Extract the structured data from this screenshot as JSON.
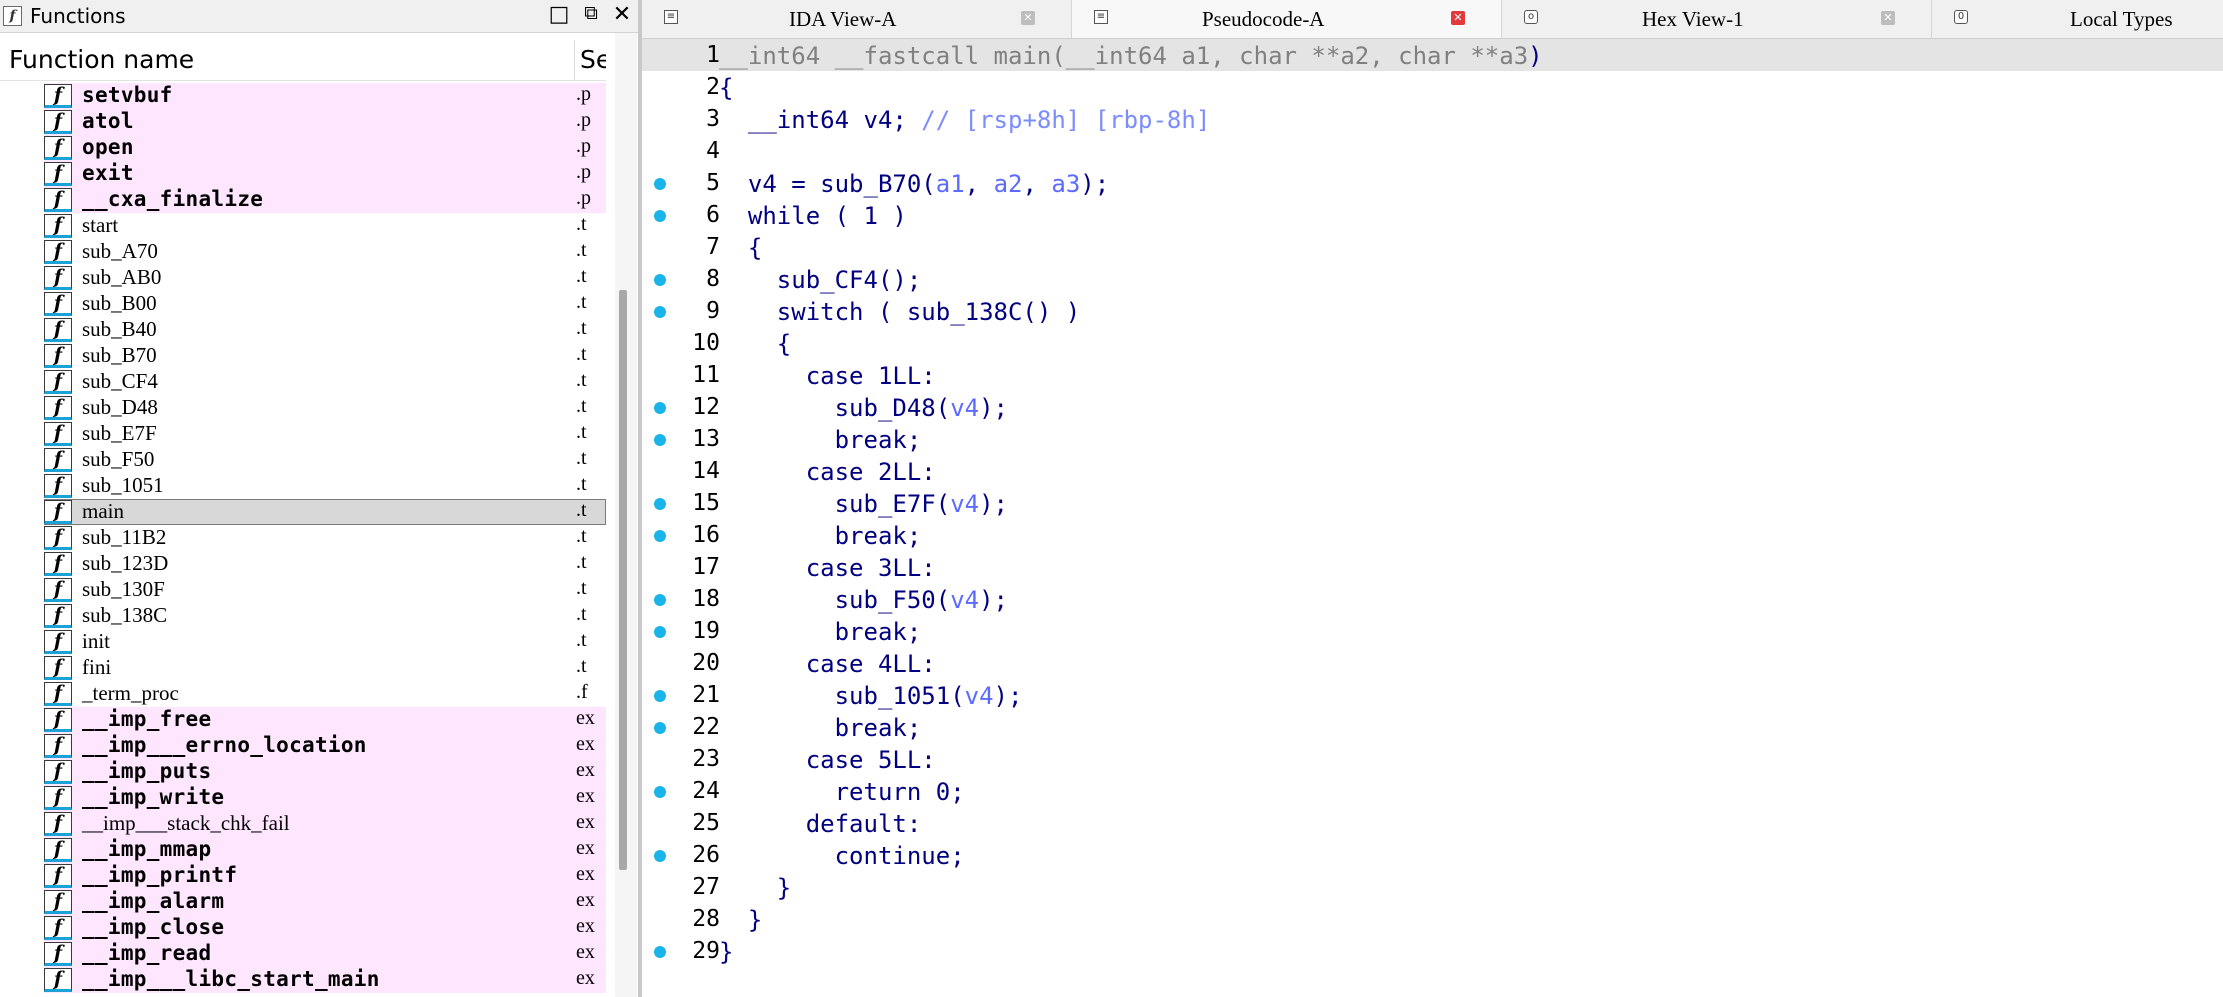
{
  "functions_window": {
    "title": "Functions",
    "title_icon": "function-window-icon",
    "columns": {
      "name": "Function name",
      "segment": "Se"
    },
    "rows": [
      {
        "name": "setvbuf",
        "segment": ".p",
        "imported": true
      },
      {
        "name": "atol",
        "segment": ".p",
        "imported": true
      },
      {
        "name": "open",
        "segment": ".p",
        "imported": true
      },
      {
        "name": "exit",
        "segment": ".p",
        "imported": true
      },
      {
        "name": "__cxa_finalize",
        "segment": ".p",
        "imported": true
      },
      {
        "name": "start",
        "segment": ".t"
      },
      {
        "name": "sub_A70",
        "segment": ".t"
      },
      {
        "name": "sub_AB0",
        "segment": ".t"
      },
      {
        "name": "sub_B00",
        "segment": ".t"
      },
      {
        "name": "sub_B40",
        "segment": ".t"
      },
      {
        "name": "sub_B70",
        "segment": ".t"
      },
      {
        "name": "sub_CF4",
        "segment": ".t"
      },
      {
        "name": "sub_D48",
        "segment": ".t"
      },
      {
        "name": "sub_E7F",
        "segment": ".t"
      },
      {
        "name": "sub_F50",
        "segment": ".t"
      },
      {
        "name": "sub_1051",
        "segment": ".t"
      },
      {
        "name": "main",
        "segment": ".t",
        "selected": true
      },
      {
        "name": "sub_11B2",
        "segment": ".t"
      },
      {
        "name": "sub_123D",
        "segment": ".t"
      },
      {
        "name": "sub_130F",
        "segment": ".t"
      },
      {
        "name": "sub_138C",
        "segment": ".t"
      },
      {
        "name": "init",
        "segment": ".t"
      },
      {
        "name": "fini",
        "segment": ".t"
      },
      {
        "name": "_term_proc",
        "segment": ".f"
      },
      {
        "name": "__imp_free",
        "segment": "ex",
        "imported": true
      },
      {
        "name": "__imp___errno_location",
        "segment": "ex",
        "imported": true
      },
      {
        "name": "__imp_puts",
        "segment": "ex",
        "imported": true
      },
      {
        "name": "__imp_write",
        "segment": "ex",
        "imported": true
      },
      {
        "name": "__imp___stack_chk_fail",
        "segment": "ex",
        "imported": true,
        "plain": true
      },
      {
        "name": "__imp_mmap",
        "segment": "ex",
        "imported": true
      },
      {
        "name": "__imp_printf",
        "segment": "ex",
        "imported": true
      },
      {
        "name": "__imp_alarm",
        "segment": "ex",
        "imported": true
      },
      {
        "name": "__imp_close",
        "segment": "ex",
        "imported": true
      },
      {
        "name": "__imp_read",
        "segment": "ex",
        "imported": true
      },
      {
        "name": "__imp___libc_start_main",
        "segment": "ex",
        "imported": true
      }
    ]
  },
  "tabs": [
    {
      "label": "IDA View-A",
      "icon": "disassembly-icon",
      "active": false,
      "closable": true
    },
    {
      "label": "Pseudocode-A",
      "icon": "pseudocode-icon",
      "active": true,
      "closable": true
    },
    {
      "label": "Hex View-1",
      "icon": "hex-view-icon",
      "active": false,
      "closable": true
    },
    {
      "label": "Local Types",
      "icon": "local-types-icon",
      "active": false,
      "closable": false
    }
  ],
  "pseudocode": {
    "lines": [
      {
        "n": "1",
        "bp": false,
        "parts": [
          [
            "gray",
            "__int64 __fastcall main("
          ],
          [
            "gray",
            "__int64 a1, char **a2, char **a3"
          ],
          [
            "blue",
            ")"
          ]
        ]
      },
      {
        "n": "2",
        "bp": false,
        "parts": [
          [
            "blue",
            "{"
          ]
        ]
      },
      {
        "n": "3",
        "bp": false,
        "parts": [
          [
            "blue",
            "  __int64 v4; "
          ],
          [
            "cmt",
            "// [rsp+8h] [rbp-8h]"
          ]
        ]
      },
      {
        "n": "4",
        "bp": false,
        "parts": []
      },
      {
        "n": "5",
        "bp": true,
        "parts": [
          [
            "blue",
            "  v4 = sub_B70("
          ],
          [
            "var",
            "a1"
          ],
          [
            "blue",
            ", "
          ],
          [
            "var",
            "a2"
          ],
          [
            "blue",
            ", "
          ],
          [
            "var",
            "a3"
          ],
          [
            "blue",
            ");"
          ]
        ]
      },
      {
        "n": "6",
        "bp": true,
        "parts": [
          [
            "blue",
            "  while ( 1 )"
          ]
        ]
      },
      {
        "n": "7",
        "bp": false,
        "parts": [
          [
            "blue",
            "  {"
          ]
        ]
      },
      {
        "n": "8",
        "bp": true,
        "parts": [
          [
            "blue",
            "    sub_CF4();"
          ]
        ]
      },
      {
        "n": "9",
        "bp": true,
        "parts": [
          [
            "blue",
            "    switch ( sub_138C() )"
          ]
        ]
      },
      {
        "n": "10",
        "bp": false,
        "parts": [
          [
            "blue",
            "    {"
          ]
        ]
      },
      {
        "n": "11",
        "bp": false,
        "parts": [
          [
            "blue",
            "      case 1LL:"
          ]
        ]
      },
      {
        "n": "12",
        "bp": true,
        "parts": [
          [
            "blue",
            "        sub_D48("
          ],
          [
            "var",
            "v4"
          ],
          [
            "blue",
            ");"
          ]
        ]
      },
      {
        "n": "13",
        "bp": true,
        "parts": [
          [
            "blue",
            "        break;"
          ]
        ]
      },
      {
        "n": "14",
        "bp": false,
        "parts": [
          [
            "blue",
            "      case 2LL:"
          ]
        ]
      },
      {
        "n": "15",
        "bp": true,
        "parts": [
          [
            "blue",
            "        sub_E7F("
          ],
          [
            "var",
            "v4"
          ],
          [
            "blue",
            ");"
          ]
        ]
      },
      {
        "n": "16",
        "bp": true,
        "parts": [
          [
            "blue",
            "        break;"
          ]
        ]
      },
      {
        "n": "17",
        "bp": false,
        "parts": [
          [
            "blue",
            "      case 3LL:"
          ]
        ]
      },
      {
        "n": "18",
        "bp": true,
        "parts": [
          [
            "blue",
            "        sub_F50("
          ],
          [
            "var",
            "v4"
          ],
          [
            "blue",
            ");"
          ]
        ]
      },
      {
        "n": "19",
        "bp": true,
        "parts": [
          [
            "blue",
            "        break;"
          ]
        ]
      },
      {
        "n": "20",
        "bp": false,
        "parts": [
          [
            "blue",
            "      case 4LL:"
          ]
        ]
      },
      {
        "n": "21",
        "bp": true,
        "parts": [
          [
            "blue",
            "        sub_1051("
          ],
          [
            "var",
            "v4"
          ],
          [
            "blue",
            ");"
          ]
        ]
      },
      {
        "n": "22",
        "bp": true,
        "parts": [
          [
            "blue",
            "        break;"
          ]
        ]
      },
      {
        "n": "23",
        "bp": false,
        "parts": [
          [
            "blue",
            "      case 5LL:"
          ]
        ]
      },
      {
        "n": "24",
        "bp": true,
        "parts": [
          [
            "blue",
            "        return 0;"
          ]
        ]
      },
      {
        "n": "25",
        "bp": false,
        "parts": [
          [
            "blue",
            "      default:"
          ]
        ]
      },
      {
        "n": "26",
        "bp": true,
        "parts": [
          [
            "blue",
            "        continue;"
          ]
        ]
      },
      {
        "n": "27",
        "bp": false,
        "parts": [
          [
            "blue",
            "    }"
          ]
        ]
      },
      {
        "n": "28",
        "bp": false,
        "parts": [
          [
            "blue",
            "  }"
          ]
        ]
      },
      {
        "n": "29",
        "bp": true,
        "parts": [
          [
            "blue",
            "}"
          ]
        ]
      }
    ]
  },
  "colors": {
    "keyword_blue": "#000080",
    "variable": "#5b6bff",
    "comment": "#7a8cff",
    "breakpoint_dot": "#1ab4e8",
    "imported_row_bg": "#ffe6ff",
    "selected_row_bg": "#d8d8d8"
  }
}
